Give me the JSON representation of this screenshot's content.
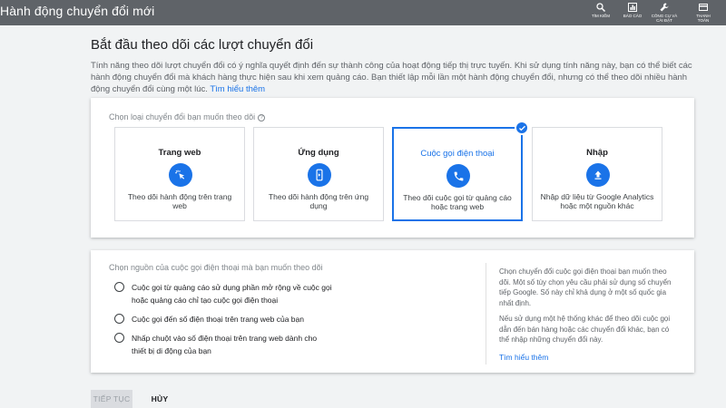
{
  "header": {
    "title": "Hành động chuyển đổi mới",
    "tools": [
      {
        "label": "TÌM KIẾM",
        "icon": "search-icon"
      },
      {
        "label": "BÁO CÁO",
        "icon": "reports-icon"
      },
      {
        "label": "CÔNG CỤ VÀ CÀI ĐẶT",
        "icon": "wrench-icon"
      },
      {
        "label": "THANH TOÁN",
        "icon": "billing-icon"
      }
    ]
  },
  "main": {
    "heading": "Bắt đầu theo dõi các lượt chuyển đổi",
    "intro": "Tính năng theo dõi lượt chuyển đổi có ý nghĩa quyết định đến sự thành công của hoạt động tiếp thị trực tuyến. Khi sử dụng tính năng này, bạn có thể biết các hành động chuyển đổi mà khách hàng thực hiện sau khi xem quảng cáo. Bạn thiết lập mỗi lần một hành động chuyển đổi, nhưng có thể theo dõi nhiều hành động chuyển đổi cùng một lúc.",
    "learn_more": "Tìm hiểu thêm"
  },
  "type_card": {
    "prompt": "Chọn loại chuyển đổi bạn muốn theo dõi",
    "help": "?",
    "options": [
      {
        "label": "Trang web",
        "desc": "Theo dõi hành động trên trang web",
        "icon": "cursor-click-icon",
        "selected": false
      },
      {
        "label": "Ứng dụng",
        "desc": "Theo dõi hành động trên ứng dụng",
        "icon": "mobile-app-icon",
        "selected": false
      },
      {
        "label": "Cuộc gọi điện thoại",
        "desc": "Theo dõi cuộc gọi từ quảng cáo hoặc trang web",
        "icon": "phone-icon",
        "selected": true
      },
      {
        "label": "Nhập",
        "desc": "Nhập dữ liệu từ Google Analytics hoặc một nguồn khác",
        "icon": "upload-icon",
        "selected": false
      }
    ]
  },
  "source_card": {
    "prompt": "Chọn nguồn của cuộc gọi điện thoại mà bạn muốn theo dõi",
    "radios": [
      "Cuộc gọi từ quảng cáo sử dụng phần mở rộng về cuộc gọi hoặc quảng cáo chỉ tạo cuộc gọi điện thoại",
      "Cuộc gọi đến số điện thoại trên trang web của bạn",
      "Nhấp chuột vào số điện thoại trên trang web dành cho thiết bị di động của bạn"
    ],
    "side_p1": "Chọn chuyển đổi cuộc gọi điện thoại bạn muốn theo dõi. Một số tùy chọn yêu cầu phải sử dụng số chuyển tiếp Google. Số này chỉ khả dụng ở một số quốc gia nhất định.",
    "side_p2": "Nếu sử dụng một hệ thống khác để theo dõi cuộc gọi dẫn đến bán hàng hoặc các chuyển đổi khác, bạn có thể nhập những chuyển đổi này.",
    "side_link": "Tìm hiểu thêm"
  },
  "footer": {
    "continue": "TIẾP TỤC",
    "cancel": "HỦY"
  },
  "colors": {
    "accent": "#1a73e8",
    "header_bg": "#5f6368",
    "page_bg": "#f1f3f4"
  }
}
